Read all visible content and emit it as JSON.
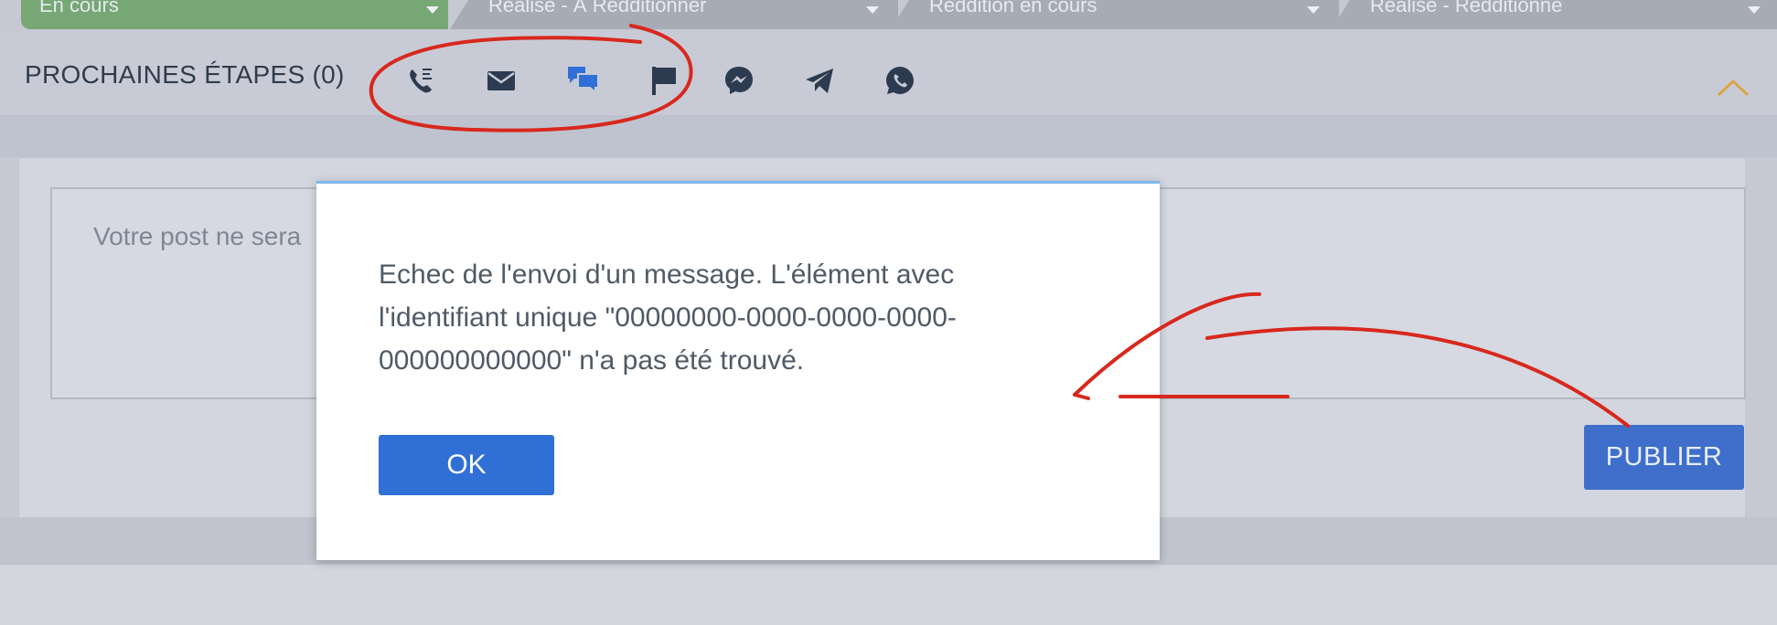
{
  "stages": [
    {
      "label": "En cours",
      "active": true
    },
    {
      "label": "Réalisé - À Rédditionner",
      "active": false
    },
    {
      "label": "Réddition en cours",
      "active": false
    },
    {
      "label": "Réalisé - Rédditionné",
      "active": false
    }
  ],
  "next_steps": {
    "title": "PROCHAINES ÉTAPES (0)",
    "icons": [
      "phone-call-icon",
      "email-icon",
      "chat-icon",
      "flag-icon",
      "messenger-icon",
      "telegram-icon",
      "whatsapp-icon"
    ]
  },
  "post": {
    "placeholder": "Votre post ne sera",
    "publish_label": "PUBLIER"
  },
  "dialog": {
    "message": "Echec de l'envoi d'un message. L'élément avec l'identifiant unique \"00000000-0000-0000-0000-000000000000\" n'a pas été trouvé.",
    "ok_label": "OK"
  },
  "colors": {
    "active_stage": "#76a775",
    "primary_button": "#2f6fd6",
    "icon_dark": "#2c3b4f",
    "icon_active": "#2f6fd6",
    "annotation": "#d8281d"
  }
}
